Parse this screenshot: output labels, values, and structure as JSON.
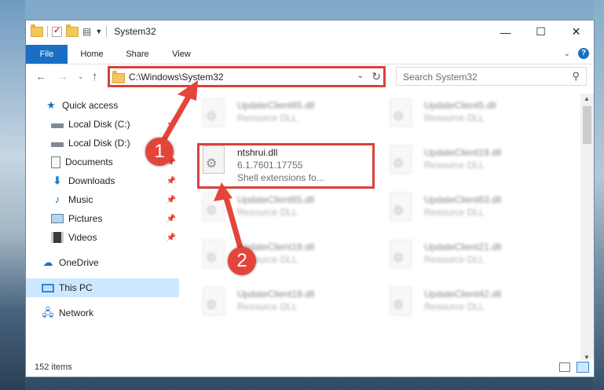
{
  "window": {
    "title": "System32",
    "minimize": "—",
    "maximize": "☐",
    "close": "✕"
  },
  "ribbon": {
    "tabs": [
      "File",
      "Home",
      "Share",
      "View"
    ],
    "expand": "⌄",
    "help": "?"
  },
  "address": {
    "path": "C:\\Windows\\System32",
    "search_placeholder": "Search System32"
  },
  "sidebar": {
    "items": [
      {
        "label": "Quick access",
        "icon": "star-icon",
        "pinned": false
      },
      {
        "label": "Local Disk (C:)",
        "icon": "drive-icon",
        "pinned": true
      },
      {
        "label": "Local Disk (D:)",
        "icon": "drive-icon",
        "pinned": false
      },
      {
        "label": "Documents",
        "icon": "documents-icon",
        "pinned": true
      },
      {
        "label": "Downloads",
        "icon": "download-icon",
        "pinned": true
      },
      {
        "label": "Music",
        "icon": "music-icon",
        "pinned": true
      },
      {
        "label": "Pictures",
        "icon": "pictures-icon",
        "pinned": true
      },
      {
        "label": "Videos",
        "icon": "videos-icon",
        "pinned": true
      },
      {
        "label": "OneDrive",
        "icon": "onedrive-icon",
        "pinned": false
      },
      {
        "label": "This PC",
        "icon": "this-pc-icon",
        "pinned": false,
        "selected": true
      },
      {
        "label": "Network",
        "icon": "network-icon",
        "pinned": false
      }
    ]
  },
  "files": [
    {
      "name": "UpdateClient65.dll",
      "l2": "Resource DLL",
      "l3": ""
    },
    {
      "name": "UpdateClient5.dll",
      "l2": "Resource DLL",
      "l3": ""
    },
    {
      "name": "ntshrui.dll",
      "l2": "6.1.7601.17755",
      "l3": "Shell extensions fo..."
    },
    {
      "name": "UpdateClient19.dll",
      "l2": "Resource DLL",
      "l3": ""
    },
    {
      "name": "UpdateClient65.dll",
      "l2": "Resource DLL",
      "l3": ""
    },
    {
      "name": "UpdateClient63.dll",
      "l2": "Resource DLL",
      "l3": ""
    },
    {
      "name": "UpdateClient19.dll",
      "l2": "Resource DLL",
      "l3": ""
    },
    {
      "name": "UpdateClient21.dll",
      "l2": "Resource DLL",
      "l3": ""
    },
    {
      "name": "UpdateClient19.dll",
      "l2": "Resource DLL",
      "l3": ""
    },
    {
      "name": "UpdateClient42.dll",
      "l2": "Resource DLL",
      "l3": ""
    }
  ],
  "status": {
    "count": "152 items"
  },
  "annotations": {
    "badge1": "1",
    "badge2": "2",
    "color": "#e4453a"
  }
}
